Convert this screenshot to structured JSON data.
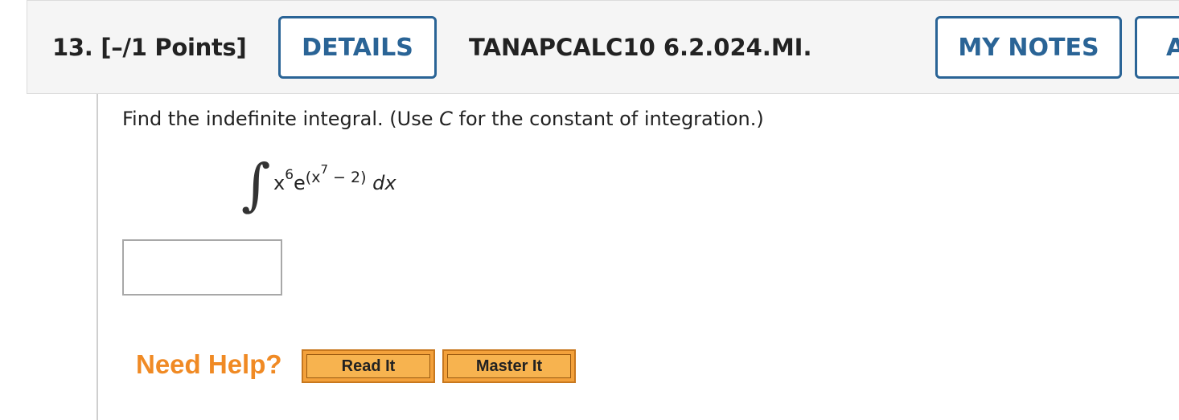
{
  "header": {
    "question_label": "13.  [–/1 Points]",
    "details_label": "DETAILS",
    "problem_id": "TANAPCALC10 6.2.024.MI.",
    "my_notes_label": "MY NOTES",
    "ask_label_partial": "A"
  },
  "problem": {
    "instruction_prefix": "Find the indefinite integral. (Use ",
    "instruction_var": "C",
    "instruction_suffix": " for the constant of integration.)",
    "integral_symbol": "∫",
    "base": "x",
    "base_power": "6",
    "e": "e",
    "exp_open": "(x",
    "exp_power": "7",
    "exp_rest": " − 2)",
    "differential": "dx"
  },
  "answer": {
    "value": "",
    "placeholder": ""
  },
  "help": {
    "need_help_label": "Need Help?",
    "read_it_label": "Read It",
    "master_it_label": "Master It"
  }
}
